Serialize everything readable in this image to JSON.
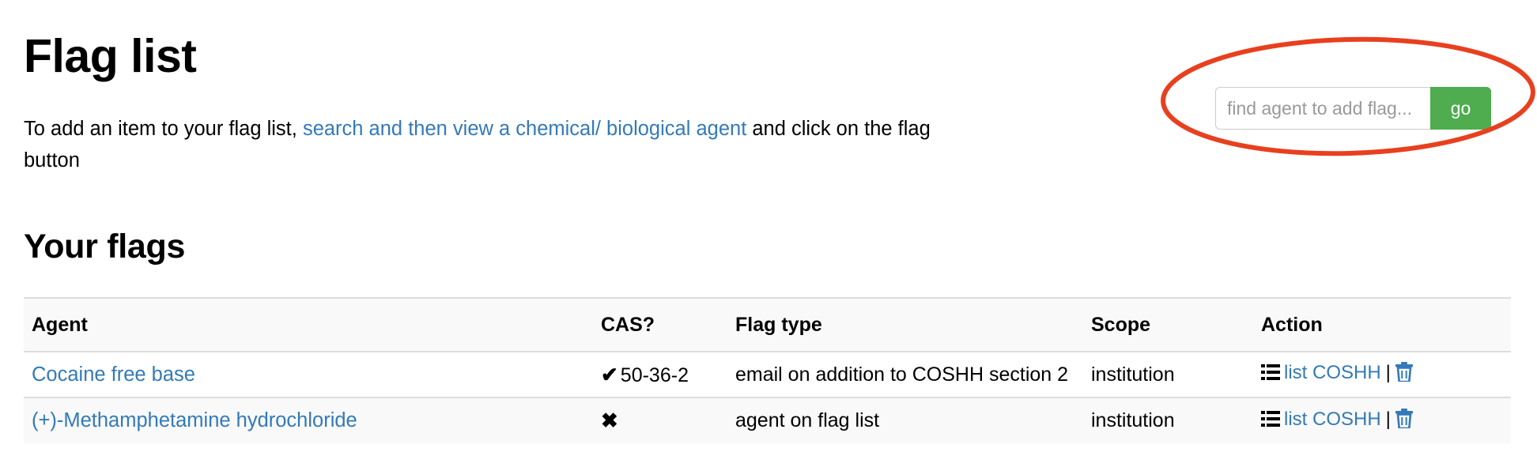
{
  "page": {
    "title": "Flag list",
    "intro_prefix": "To add an item to your flag list, ",
    "intro_link": "search and then view a chemical/ biological agent",
    "intro_suffix": " and click on the flag button",
    "section_title": "Your flags"
  },
  "search": {
    "placeholder": "find agent to add flag...",
    "value": "",
    "button_label": "go",
    "button_color": "#4fad4f",
    "annotation_color": "#e8401f"
  },
  "table": {
    "columns": [
      "Agent",
      "CAS?",
      "Flag type",
      "Scope",
      "Action"
    ],
    "rows": [
      {
        "agent": "Cocaine free base",
        "cas_mark": "✔",
        "cas_has": true,
        "cas": "50-36-2",
        "flag_type": "email on addition to COSHH section 2",
        "scope": "institution",
        "action_link": "list COSHH",
        "action_separator": "|"
      },
      {
        "agent": "(+)-Methamphetamine hydrochloride",
        "cas_mark": "✖",
        "cas_has": false,
        "cas": "",
        "flag_type": "agent on flag list",
        "scope": "institution",
        "action_link": "list COSHH",
        "action_separator": "|"
      }
    ]
  },
  "colors": {
    "link": "#337ab7",
    "header_bg": "#f9f9f9",
    "border": "#dddddd"
  }
}
